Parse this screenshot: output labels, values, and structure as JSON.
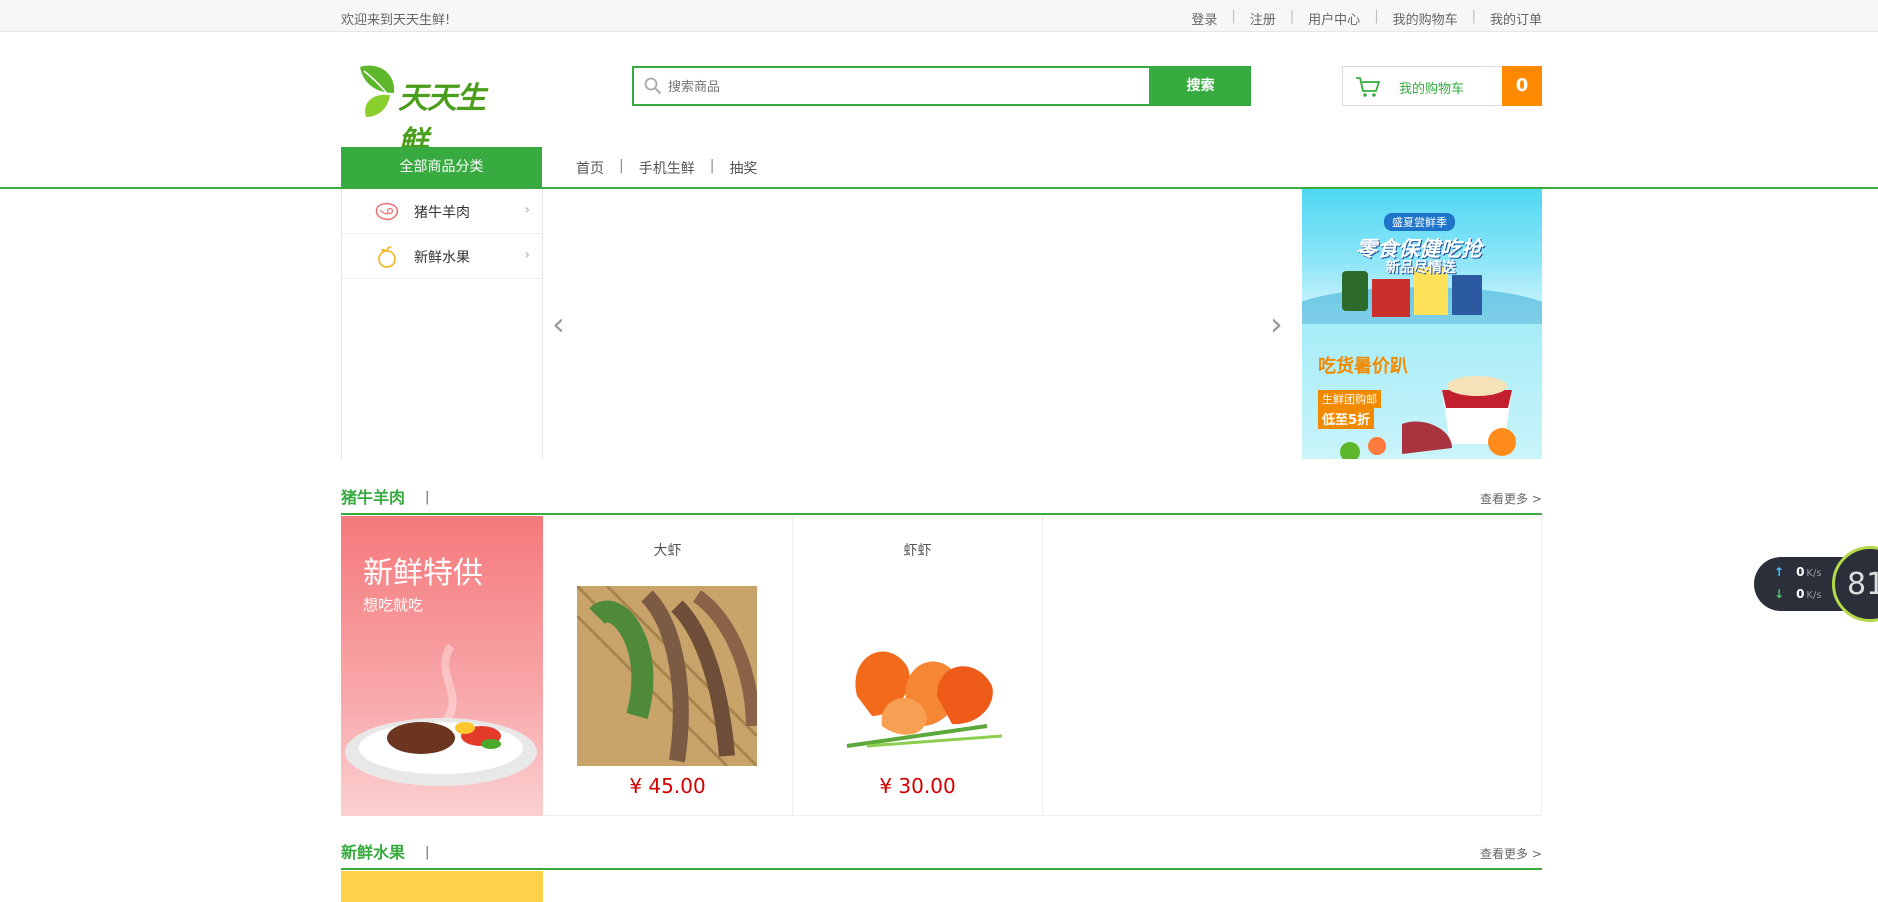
{
  "topbar": {
    "welcome": "欢迎来到天天生鲜!",
    "links": [
      "登录",
      "注册",
      "用户中心",
      "我的购物车",
      "我的订单"
    ]
  },
  "header": {
    "logo_text": "天天生鲜",
    "search_placeholder": "搜索商品",
    "search_button": "搜索",
    "cart_label": "我的购物车",
    "cart_count": "0"
  },
  "nav": {
    "all_categories": "全部商品分类",
    "links": [
      "首页",
      "手机生鲜",
      "抽奖"
    ]
  },
  "categories": [
    {
      "label": "猪牛羊肉",
      "icon": "meat-icon"
    },
    {
      "label": "新鲜水果",
      "icon": "fruit-icon"
    }
  ],
  "slider": {
    "prev": "‹",
    "next": "›"
  },
  "promos": [
    {
      "tag": "盛夏尝鲜季",
      "title": "零食保健吃抢",
      "sub": "新品尽情送"
    },
    {
      "title": "吃货暑价趴",
      "sub1": "生鲜团购邮",
      "sub2": "低至5折"
    }
  ],
  "floors": [
    {
      "title": "猪牛羊肉",
      "bar": "|",
      "more": "查看更多 >",
      "banner_title": "新鲜特供",
      "banner_sub": "想吃就吃",
      "goods": [
        {
          "name": "大虾",
          "price": "¥ 45.00"
        },
        {
          "name": "虾虾",
          "price": "¥ 30.00"
        }
      ]
    },
    {
      "title": "新鲜水果",
      "bar": "|",
      "more": "查看更多 >"
    }
  ],
  "speed_widget": {
    "up_value": "0",
    "up_unit": "K/s",
    "down_value": "0",
    "down_unit": "K/s",
    "percent": "81"
  },
  "colors": {
    "brand_green": "#37ab40",
    "cart_orange": "#ff8a00",
    "price_red": "#d40000"
  }
}
